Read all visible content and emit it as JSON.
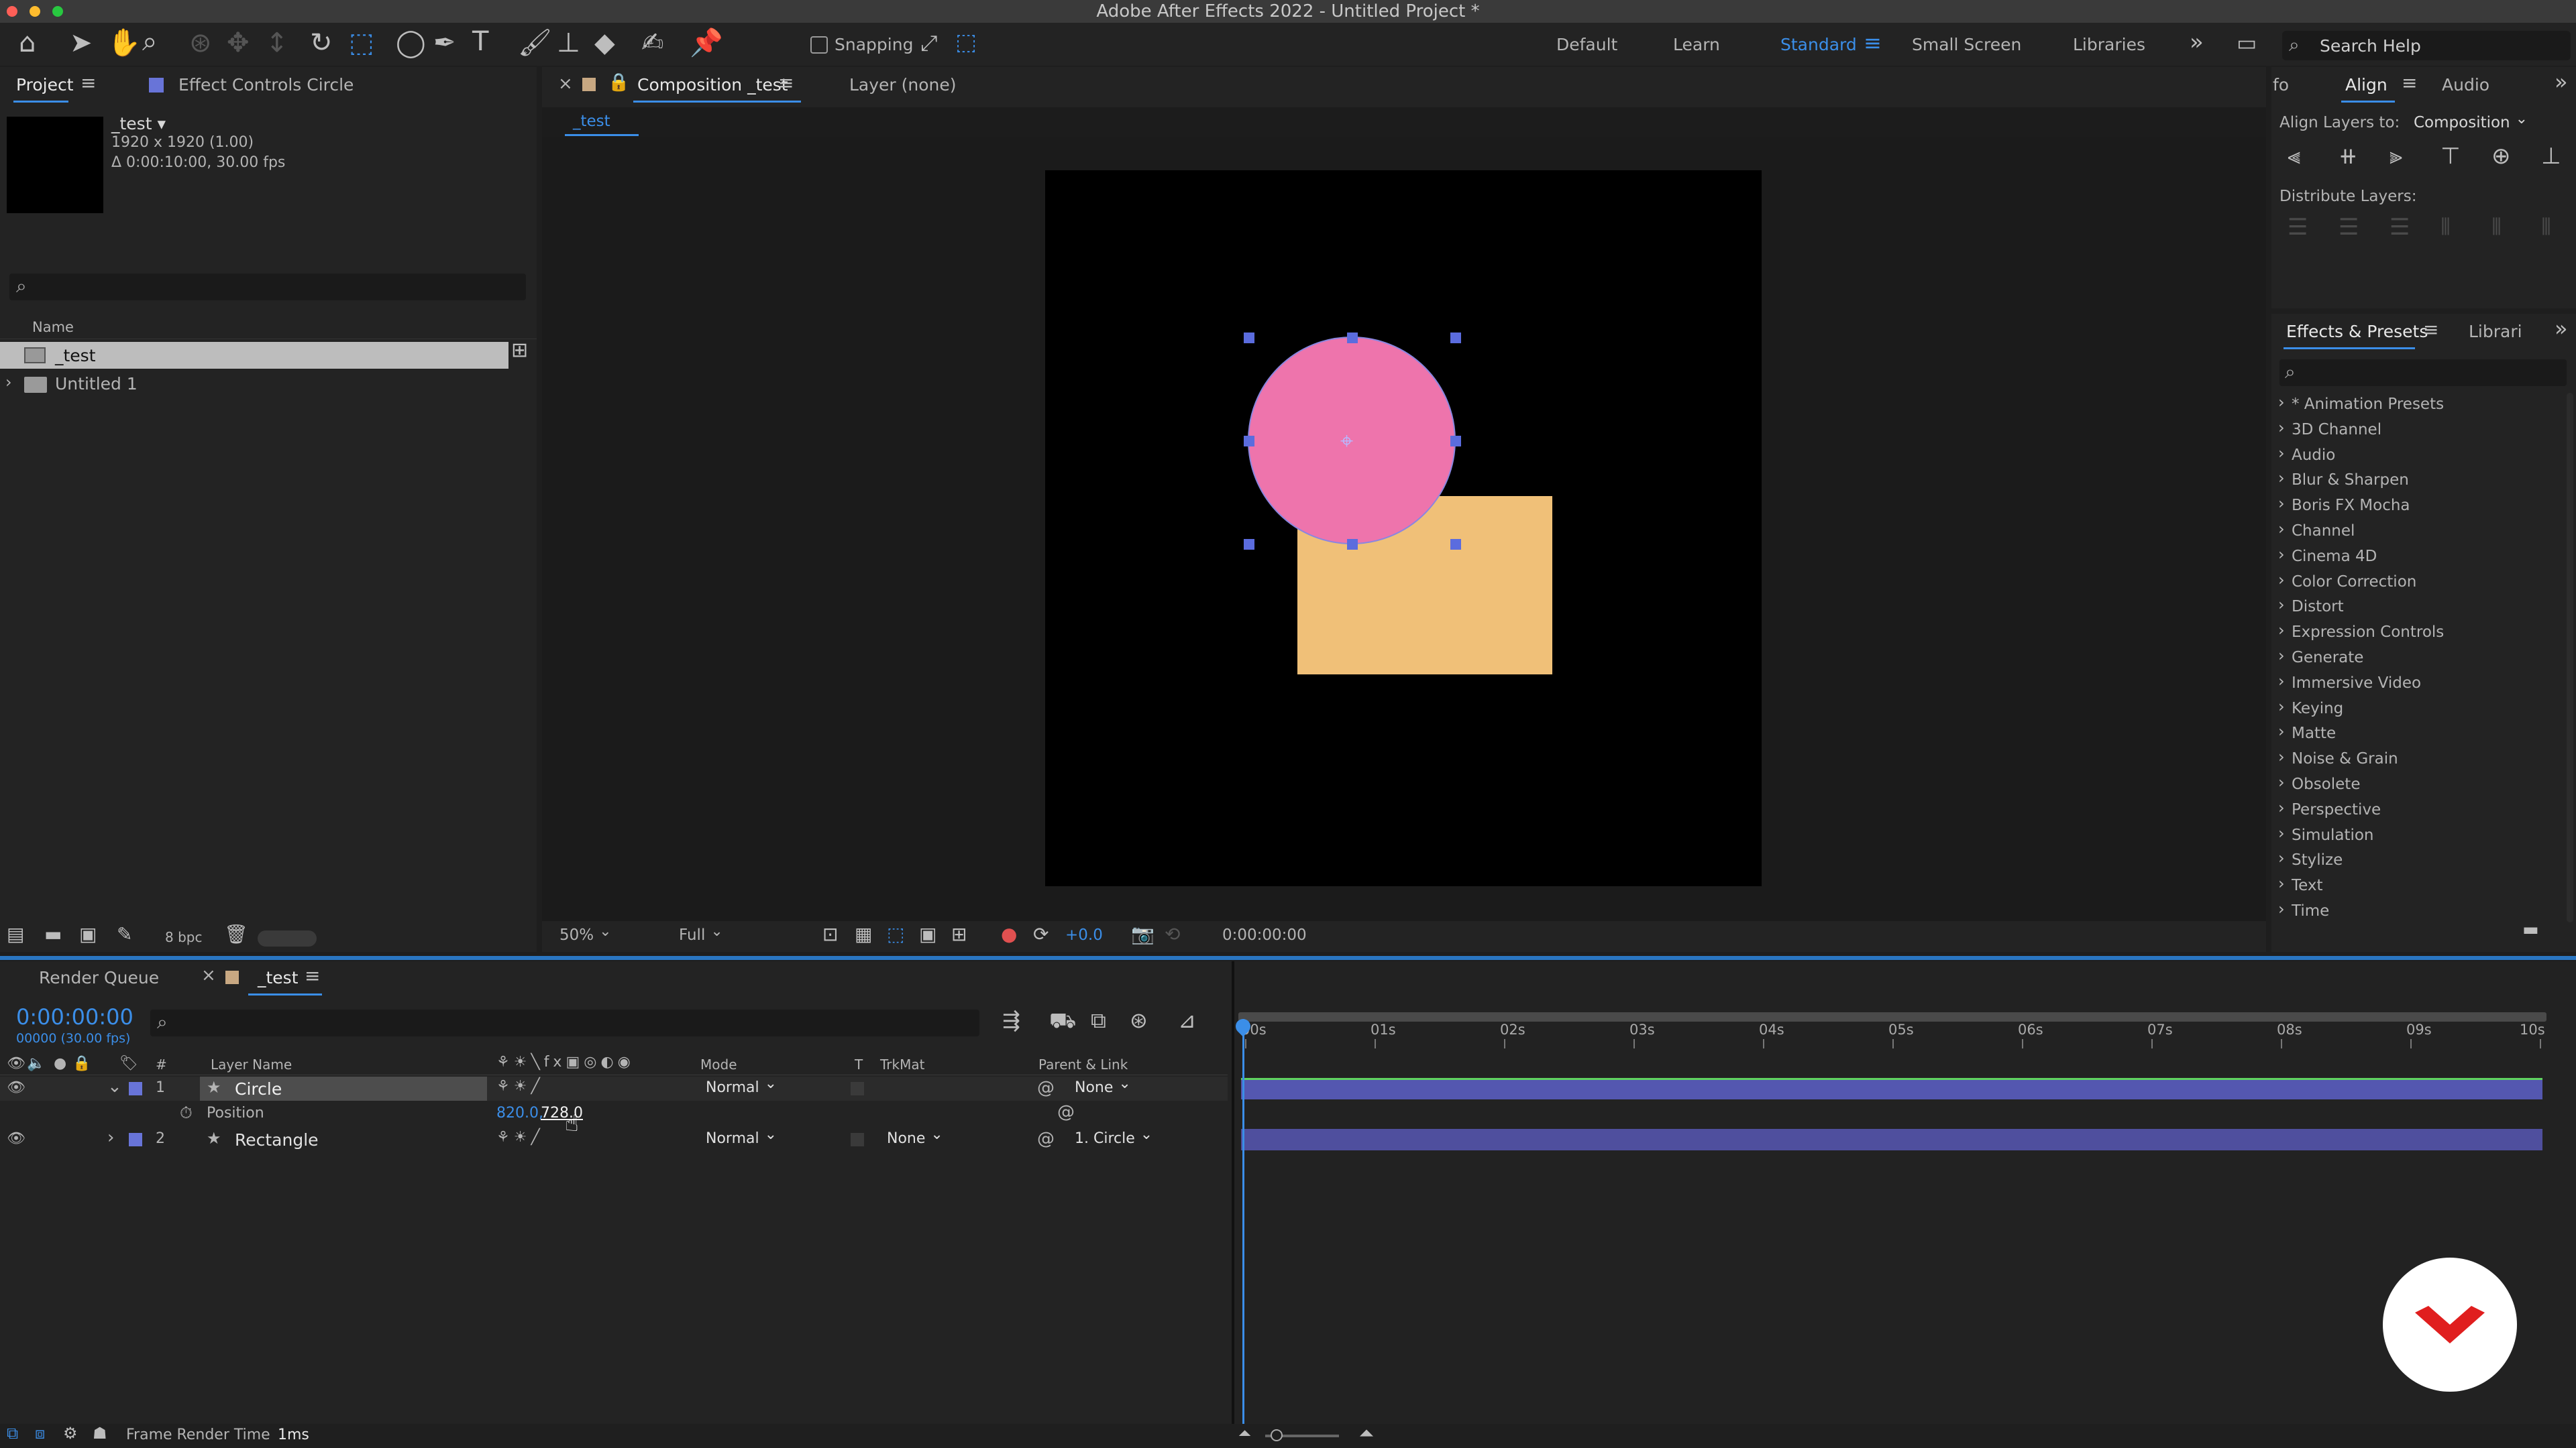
{
  "window": {
    "title": "Adobe After Effects 2022 - Untitled Project *"
  },
  "toolbar": {
    "snapping_label": "Snapping",
    "workspaces": [
      "Default",
      "Learn",
      "Standard",
      "Small Screen",
      "Libraries"
    ],
    "active_workspace": "Standard",
    "search_placeholder": "Search Help"
  },
  "project_panel": {
    "tab_project": "Project",
    "tab_effect_controls": "Effect Controls Circle",
    "item_name": "_test ▾",
    "item_size": "1920 x 1920 (1.00)",
    "item_duration": "Δ 0:00:10:00, 30.00 fps",
    "col_name": "Name",
    "rows": [
      "_test",
      "Untitled 1"
    ],
    "bpc_label": "8 bpc"
  },
  "composition_panel": {
    "tab_comp": "Composition _test",
    "tab_layer": "Layer (none)",
    "subtab": "_test",
    "zoom": "50%",
    "resolution": "Full",
    "exposure": "+0.0",
    "timecode": "0:00:00:00",
    "colors": {
      "circle": "#ee74ac",
      "rectangle": "#f0c078"
    }
  },
  "align_panel": {
    "tab_info": "fo",
    "tab_align": "Align",
    "tab_audio": "Audio",
    "align_to_label": "Align Layers to:",
    "align_to_value": "Composition",
    "distribute_label": "Distribute Layers:"
  },
  "effects_panel": {
    "tab_effects": "Effects & Presets",
    "tab_libraries": "Librari",
    "items": [
      "* Animation Presets",
      "3D Channel",
      "Audio",
      "Blur & Sharpen",
      "Boris FX Mocha",
      "Channel",
      "Cinema 4D",
      "Color Correction",
      "Distort",
      "Expression Controls",
      "Generate",
      "Immersive Video",
      "Keying",
      "Matte",
      "Noise & Grain",
      "Obsolete",
      "Perspective",
      "Simulation",
      "Stylize",
      "Text",
      "Time"
    ]
  },
  "timeline": {
    "tab_render_queue": "Render Queue",
    "tab_comp": "_test",
    "timecode": "0:00:00:00",
    "frame_info": "00000 (30.00 fps)",
    "col_layer_name": "Layer Name",
    "col_mode": "Mode",
    "col_t": "T",
    "col_trkmat": "TrkMat",
    "col_parent": "Parent & Link",
    "col_num": "#",
    "ruler": [
      "00s",
      "01s",
      "02s",
      "03s",
      "04s",
      "05s",
      "06s",
      "07s",
      "08s",
      "09s",
      "10s"
    ],
    "layers": [
      {
        "num": "1",
        "name": "Circle",
        "mode": "Normal",
        "trkmat": "",
        "parent": "None"
      },
      {
        "num": "2",
        "name": "Rectangle",
        "mode": "Normal",
        "trkmat": "None",
        "parent": "1. Circle"
      }
    ],
    "position_label": "Position",
    "position_x": "820.0,",
    "position_y": "728.0"
  },
  "status_bar": {
    "frame_render_label": "Frame Render Time",
    "frame_render_value": "1ms"
  }
}
